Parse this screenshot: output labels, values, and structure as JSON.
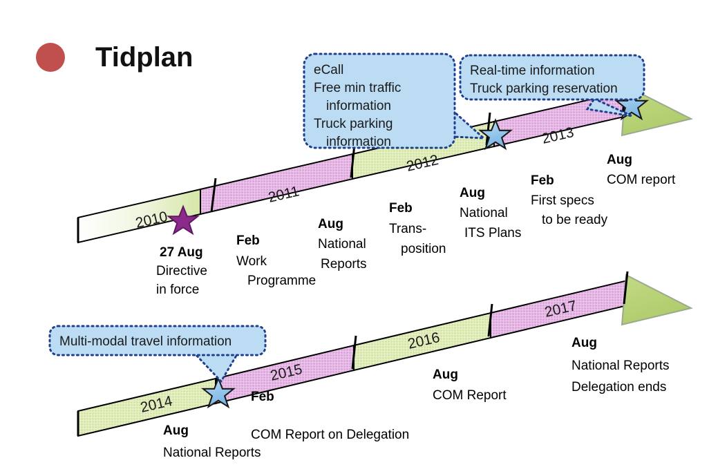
{
  "header": {
    "bullet_color": "#c0504d",
    "title": "Tidplan"
  },
  "palette": {
    "green": "#d3e4a3",
    "pink": "#e0b2de",
    "blue_callout_fill": "#bcdcf4",
    "blue_callout_border": "#1f3f8f",
    "blue_star": "#8cc4ea",
    "purple_star": "#8c2a8c",
    "arrow_green": "#bcd77e",
    "outline": "#000000"
  },
  "callouts": [
    {
      "id": "ecall-callout",
      "lines": [
        "eCall",
        "Free min traffic",
        "information",
        "Truck parking",
        "information"
      ]
    },
    {
      "id": "realtime-callout",
      "lines": [
        "Real-time information",
        "Truck parking reservation"
      ]
    },
    {
      "id": "multimodal-callout",
      "lines": [
        "Multi-modal travel information"
      ]
    }
  ],
  "timelines": [
    {
      "id": "timeline-2010-2013",
      "years": [
        "2010",
        "2011",
        "2012",
        "2013"
      ],
      "milestones": [
        {
          "date": "27 Aug",
          "lines": [
            "Directive",
            "in force"
          ],
          "star": "purple"
        },
        {
          "date": "Feb",
          "lines": [
            "Work",
            "Programme"
          ],
          "star": "none"
        },
        {
          "date": "Aug",
          "lines": [
            "National",
            "Reports"
          ],
          "star": "none"
        },
        {
          "date": "Feb",
          "lines": [
            "Trans-",
            "position"
          ],
          "star": "none"
        },
        {
          "date": "Aug",
          "lines": [
            "National",
            "ITS Plans"
          ],
          "star": "blue"
        },
        {
          "date": "Feb",
          "lines": [
            "First specs",
            "to be ready"
          ],
          "star": "none"
        },
        {
          "date": "Aug",
          "lines": [
            "COM report"
          ],
          "star": "blue"
        }
      ]
    },
    {
      "id": "timeline-2014-2017",
      "years": [
        "2014",
        "2015",
        "2016",
        "2017"
      ],
      "milestones": [
        {
          "date": "Aug",
          "lines": [
            "National Reports"
          ],
          "star": "blue"
        },
        {
          "date": "Feb",
          "lines": [
            "COM Report on Delegation"
          ],
          "star": "none"
        },
        {
          "date": "Aug",
          "lines": [
            "COM Report"
          ],
          "star": "none"
        },
        {
          "date": "Aug",
          "lines": [
            "National Reports",
            "Delegation ends"
          ],
          "star": "none"
        }
      ]
    }
  ],
  "labels": {
    "r1": {
      "m0_date": "27 Aug",
      "m0_l1": "Directive",
      "m0_l2": "in force",
      "m1_date": "Feb",
      "m1_l1": "Work",
      "m1_l2": "Programme",
      "m2_date": "Aug",
      "m2_l1": "National",
      "m2_l2": "Reports",
      "m3_date": "Feb",
      "m3_l1": "Trans-",
      "m3_l2": "position",
      "m4_date": "Aug",
      "m4_l1": "National",
      "m4_l2": "ITS Plans",
      "m5_date": "Feb",
      "m5_l1": "First specs",
      "m5_l2": "to be ready",
      "m6_date": "Aug",
      "m6_l1": "COM report",
      "y0": "2010",
      "y1": "2011",
      "y2": "2012",
      "y3": "2013"
    },
    "r2": {
      "m0_date": "Aug",
      "m0_l1": "National Reports",
      "m1_date": "Feb",
      "m1_l1": "COM Report on Delegation",
      "m2_date": "Aug",
      "m2_l1": "COM Report",
      "m3_date": "Aug",
      "m3_l1": "National Reports",
      "m3_l2": "Delegation ends",
      "y0": "2014",
      "y1": "2015",
      "y2": "2016",
      "y3": "2017"
    },
    "c1": {
      "l1": "eCall",
      "l2": "Free min traffic",
      "l3": "information",
      "l4": "Truck parking",
      "l5": "information"
    },
    "c2": {
      "l1": "Real-time information",
      "l2": "Truck parking reservation"
    },
    "c3": {
      "l1": "Multi-modal travel information"
    }
  }
}
